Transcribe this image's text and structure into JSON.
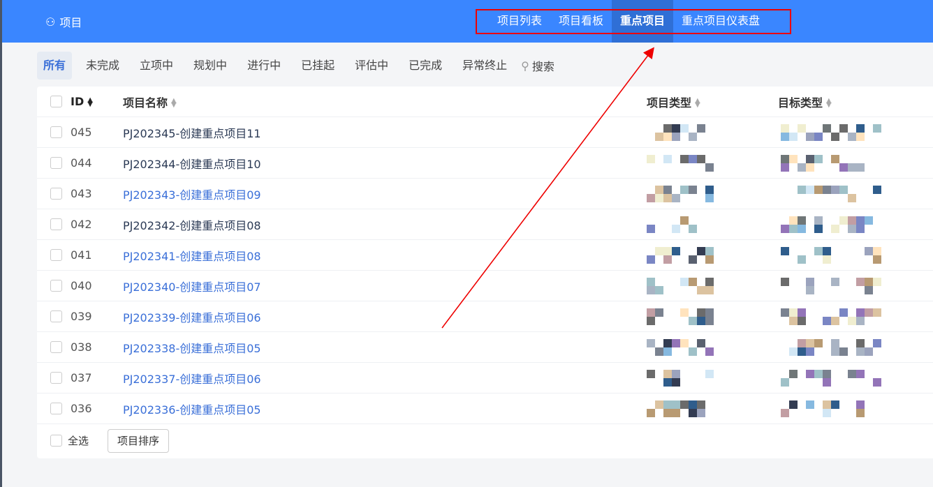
{
  "header": {
    "brand": "项目",
    "nav": [
      {
        "label": "项目列表"
      },
      {
        "label": "项目看板"
      },
      {
        "label": "重点项目",
        "active": true
      },
      {
        "label": "重点项目仪表盘"
      }
    ]
  },
  "filters": {
    "items": [
      "所有",
      "未完成",
      "立项中",
      "规划中",
      "进行中",
      "已挂起",
      "评估中",
      "已完成",
      "异常终止"
    ],
    "search": "搜索"
  },
  "table": {
    "columns": [
      "ID",
      "项目名称",
      "项目类型",
      "目标类型"
    ],
    "rows": [
      {
        "id": "045",
        "name": "PJ202345-创建重点项目11",
        "color": "#2b3a55"
      },
      {
        "id": "044",
        "name": "PJ202344-创建重点项目10",
        "color": "#2b3a55"
      },
      {
        "id": "043",
        "name": "PJ202343-创建重点项目09",
        "color": "#3a6fd8"
      },
      {
        "id": "042",
        "name": "PJ202342-创建重点项目08",
        "color": "#2b3a55"
      },
      {
        "id": "041",
        "name": "PJ202341-创建重点项目08",
        "color": "#3a6fd8"
      },
      {
        "id": "040",
        "name": "PJ202340-创建重点项目07",
        "color": "#3a6fd8"
      },
      {
        "id": "039",
        "name": "PJ202339-创建重点项目06",
        "color": "#3a6fd8"
      },
      {
        "id": "038",
        "name": "PJ202338-创建重点项目05",
        "color": "#3a6fd8"
      },
      {
        "id": "037",
        "name": "PJ202337-创建重点项目06",
        "color": "#3a6fd8"
      },
      {
        "id": "036",
        "name": "PJ202336-创建重点项目05",
        "color": "#3a6fd8"
      }
    ]
  },
  "footer": {
    "select_all": "全选",
    "sort_button": "项目排序"
  }
}
